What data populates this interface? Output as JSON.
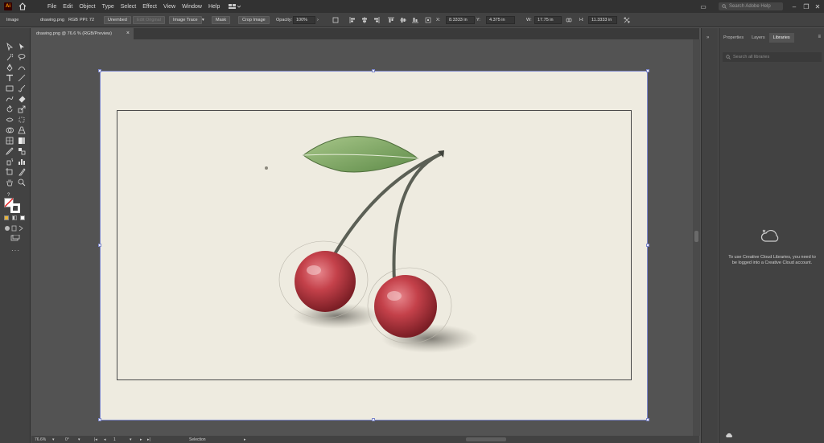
{
  "menubar": {
    "logo": "Ai",
    "items": [
      "File",
      "Edit",
      "Object",
      "Type",
      "Select",
      "Effect",
      "View",
      "Window",
      "Help"
    ],
    "search_placeholder": "Search Adobe Help"
  },
  "controlbar": {
    "selection_type": "Image",
    "filename": "drawing.png",
    "colorspace": "RGB",
    "ppi": "PPI: 72",
    "embed_button": "Unembed",
    "edit_original_button": "Edit Original",
    "image_trace_button": "Image Trace",
    "mask_button": "Mask",
    "crop_button": "Crop Image",
    "opacity_label": "Opacity:",
    "opacity_value": "100%",
    "x_label": "X:",
    "x_value": "8.3333 in",
    "y_label": "Y:",
    "y_value": "4.375 in",
    "w_label": "W:",
    "w_value": "17.75 in",
    "h_label": "H:",
    "h_value": "11.3333 in"
  },
  "document": {
    "tab_title": "drawing.png @ 76.6 % (RGB/Preview)"
  },
  "statusbar": {
    "zoom": "76.6%",
    "rotation": "0°",
    "artboard_number": "1",
    "tool": "Selection"
  },
  "panel": {
    "tabs": [
      "Properties",
      "Layers",
      "Libraries"
    ],
    "active_tab": "Libraries",
    "search_placeholder": "Search all libraries",
    "message": "To use Creative Cloud Libraries, you need to be logged into a Creative Cloud account."
  },
  "colors": {
    "artboard": "#eeebe0",
    "selection": "#7c86c9",
    "cherry": "#b8323a",
    "leaf": "#7aa05a"
  }
}
